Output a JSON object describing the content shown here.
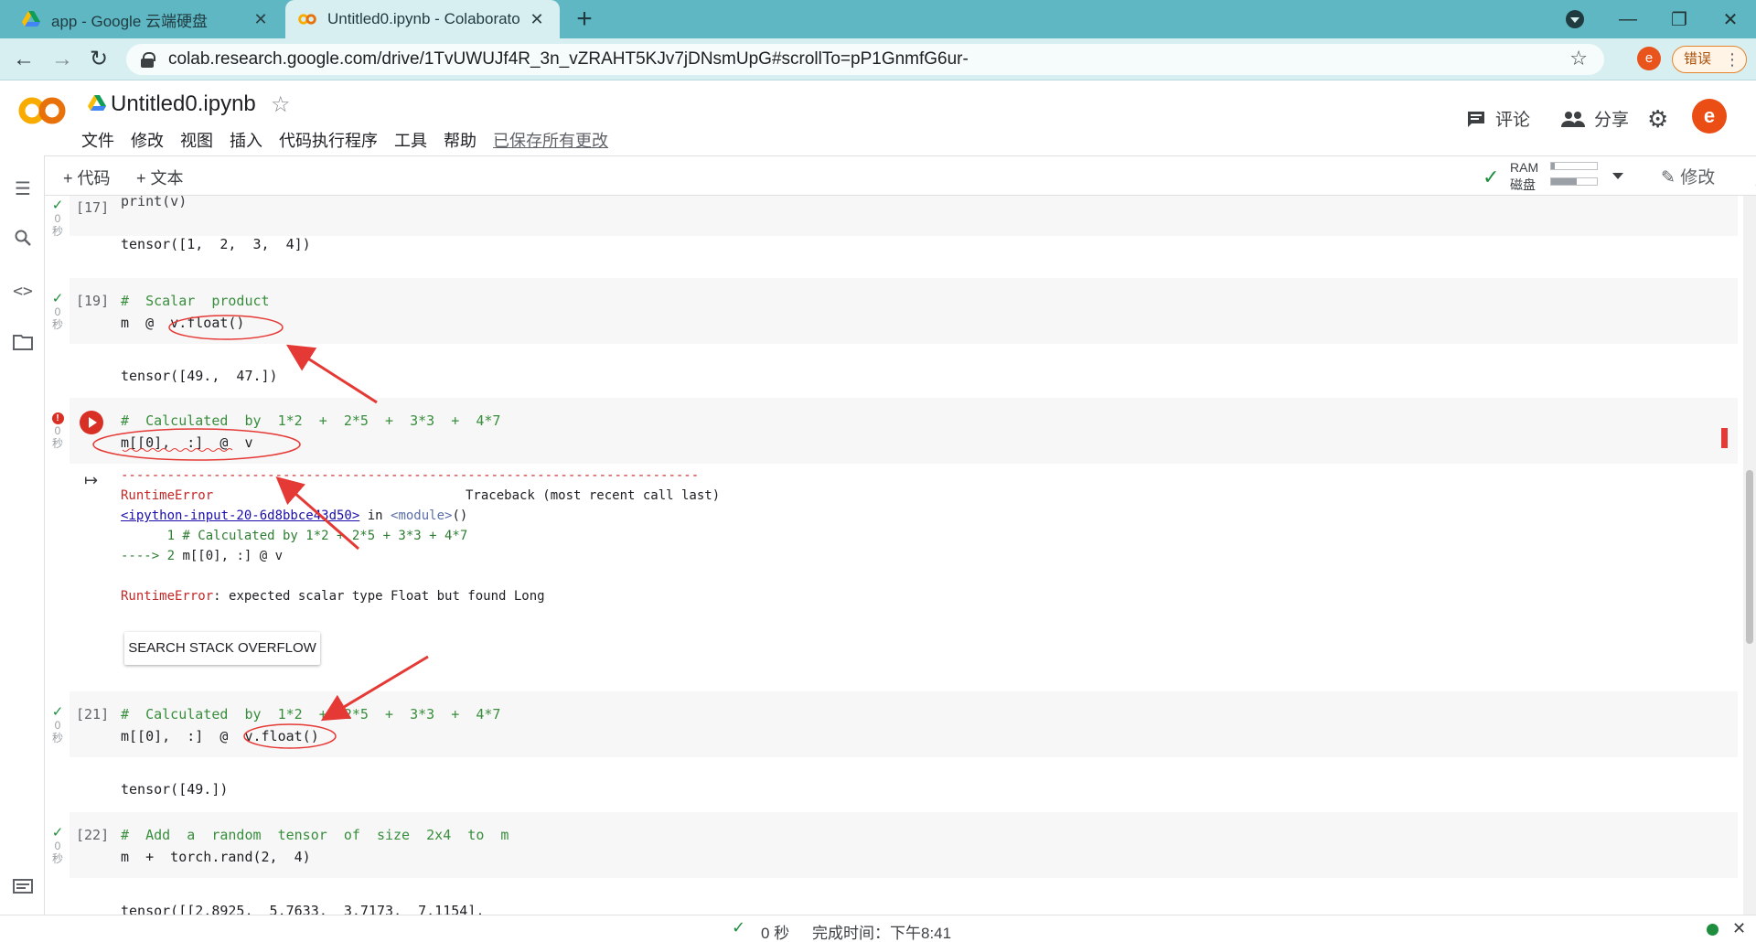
{
  "browser": {
    "tabs": [
      {
        "title": "app - Google 云端硬盘",
        "icon": "google-drive-icon"
      },
      {
        "title": "Untitled0.ipynb - Colaboratory",
        "icon": "colab-icon"
      }
    ],
    "url": "colab.research.google.com/drive/1TvUWUJf4R_3n_vZRAHT5KJv7jDNsmUpG#scrollTo=pP1GnmfG6ur-",
    "profile_initial": "e",
    "error_label": "错误"
  },
  "colab": {
    "title": "Untitled0.ipynb",
    "menu": [
      "文件",
      "修改",
      "视图",
      "插入",
      "代码执行程序",
      "工具",
      "帮助"
    ],
    "saved_status": "已保存所有更改",
    "comment_label": "评论",
    "share_label": "分享",
    "user_initial": "e",
    "add_code": "+ 代码",
    "add_text": "+ 文本",
    "ram_label": "RAM",
    "disk_label": "磁盘",
    "ram_fill": 0.08,
    "disk_fill": 0.55,
    "edit_label": "修改"
  },
  "cells": {
    "c17": {
      "num": "[17]",
      "time": "0",
      "unit": "秒",
      "code": "print(v)",
      "output": "tensor([1,  2,  3,  4])"
    },
    "c19": {
      "num": "[19]",
      "time": "0",
      "unit": "秒",
      "comment": "#  Scalar  product",
      "code": "m  @  v.float()",
      "output": "tensor([49.,  47.])"
    },
    "c20": {
      "time": "0",
      "unit": "秒",
      "comment": "#  Calculated  by  1*2  +  2*5  +  3*3  +  4*7",
      "code": "m[[0],  :]  @  v",
      "dashes": "---------------------------------------------------------------------------",
      "err_name": "RuntimeError",
      "traceback": "Traceback (most recent call last)",
      "input_link": "<ipython-input-20-6d8bbce43d50>",
      "in_text": " in ",
      "module": "<module>",
      "module_paren": "()",
      "line1": "      1 # Calculated by 1*2 + 2*5 + 3*3 + 4*7",
      "line2_arrow": "----> 2 ",
      "line2_code": "m[[0], :] @ v",
      "final_err_name": "RuntimeError",
      "final_err_msg": ": expected scalar type Float but found Long",
      "so_button": "SEARCH STACK OVERFLOW"
    },
    "c21": {
      "num": "[21]",
      "time": "0",
      "unit": "秒",
      "comment": "#  Calculated  by  1*2  +  2*5  +  3*3  +  4*7",
      "code": "m[[0],  :]  @  v.float()",
      "output": "tensor([49.])"
    },
    "c22": {
      "num": "[22]",
      "time": "0",
      "unit": "秒",
      "comment": "#  Add  a  random  tensor  of  size  2x4  to  m",
      "code": "m  +  torch.rand(2,  4)",
      "output": "tensor([[2.8925,  5.7633,  3.7173,  7.1154],"
    }
  },
  "status": {
    "time": "0 秒",
    "completed": "完成时间：下午8:41"
  }
}
